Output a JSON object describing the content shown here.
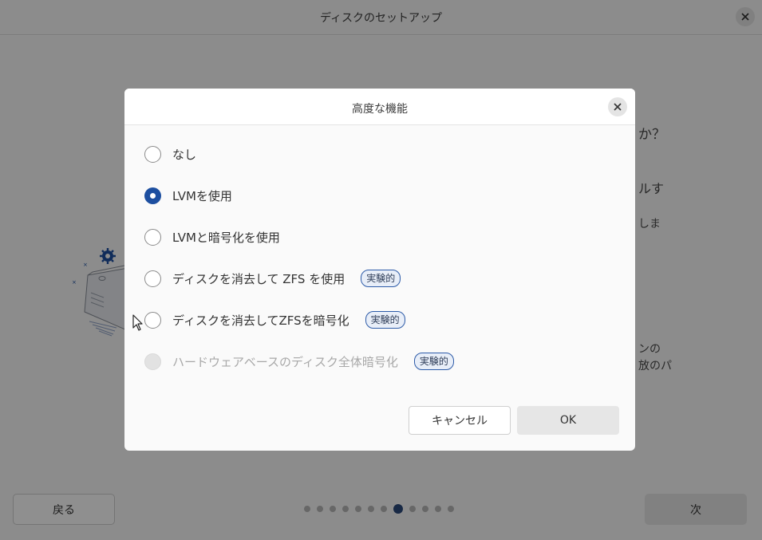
{
  "window": {
    "title": "ディスクのセットアップ",
    "close_icon": "close-icon"
  },
  "background": {
    "heading_partial": "か？",
    "line1_partial": "ルす",
    "line2_partial": "しま",
    "line3_partial": "ンの",
    "line4_partial": "放のパ"
  },
  "footer": {
    "back_label": "戻る",
    "next_label": "次",
    "total_steps": 12,
    "current_step": 8
  },
  "dialog": {
    "title": "高度な機能",
    "close_icon": "close-icon",
    "options": [
      {
        "label": "なし",
        "checked": false,
        "disabled": false,
        "badge": ""
      },
      {
        "label": "LVMを使用",
        "checked": true,
        "disabled": false,
        "badge": ""
      },
      {
        "label": "LVMと暗号化を使用",
        "checked": false,
        "disabled": false,
        "badge": ""
      },
      {
        "label": "ディスクを消去して ZFS を使用",
        "checked": false,
        "disabled": false,
        "badge": "実験的"
      },
      {
        "label": "ディスクを消去してZFSを暗号化",
        "checked": false,
        "disabled": false,
        "badge": "実験的"
      },
      {
        "label": "ハードウェアベースのディスク全体暗号化",
        "checked": false,
        "disabled": true,
        "badge": "実験的"
      }
    ],
    "cancel_label": "キャンセル",
    "ok_label": "OK"
  },
  "colors": {
    "accent": "#1d4fa0",
    "badge_border": "#2d5ba8",
    "step_active": "#2c4a7c"
  }
}
